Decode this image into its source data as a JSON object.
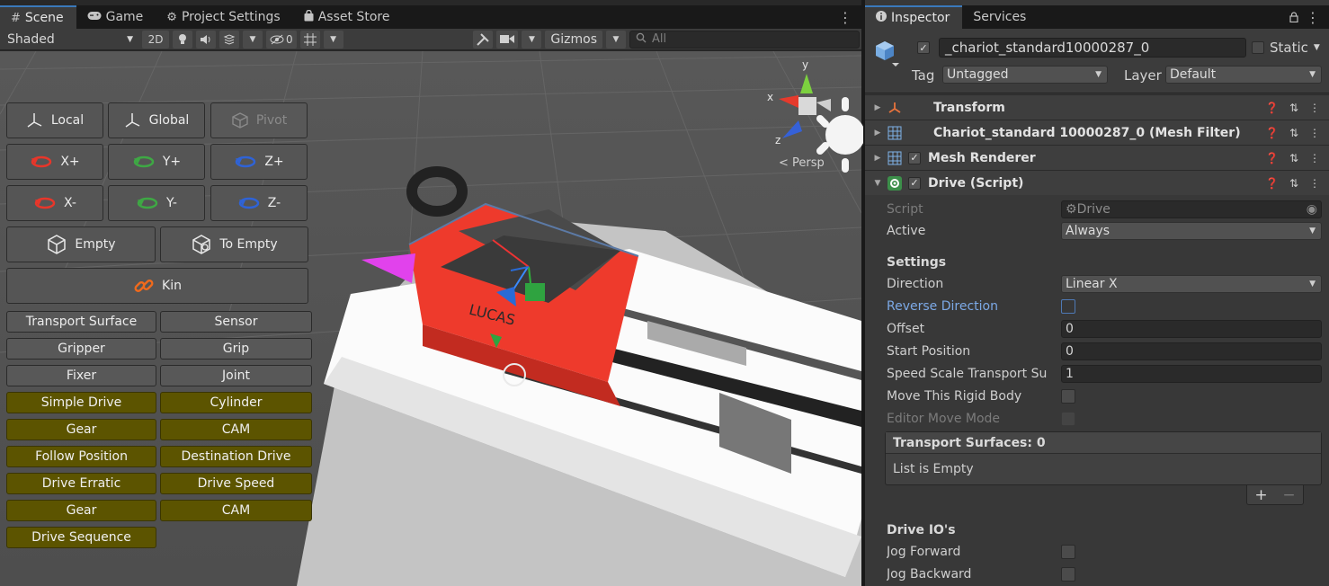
{
  "scene_tabs": [
    {
      "label": "Scene",
      "icon": "hash-icon",
      "active": true
    },
    {
      "label": "Game",
      "icon": "gamepad-icon"
    },
    {
      "label": "Project Settings",
      "icon": "gear-icon"
    },
    {
      "label": "Asset Store",
      "icon": "bag-icon"
    }
  ],
  "toolbar": {
    "shading_mode": "Shaded",
    "mode_2d": "2D",
    "hidden_count": "0",
    "gizmos": "Gizmos",
    "search_placeholder": "All"
  },
  "overlay": {
    "row1": [
      "Local",
      "Global",
      "Pivot"
    ],
    "row2": [
      "X+",
      "Y+",
      "Z+"
    ],
    "row3": [
      "X-",
      "Y-",
      "Z-"
    ],
    "row4": [
      "Empty",
      "To Empty"
    ],
    "kin": "Kin",
    "gray_buttons": [
      "Transport Surface",
      "Sensor",
      "Gripper",
      "Grip",
      "Fixer",
      "Joint"
    ],
    "olive_buttons": [
      "Simple Drive",
      "Cylinder",
      "Gear",
      "CAM",
      "Follow Position",
      "Destination Drive",
      "Drive Erratic",
      "Drive Speed",
      "Gear",
      "CAM",
      "Drive Sequence"
    ],
    "colors": {
      "x": "#e8362a",
      "y": "#3ea844",
      "z": "#2f63d6",
      "kin": "#f06a1c",
      "olive": "#5c5400"
    }
  },
  "scene_text": {
    "gizmo_x": "x",
    "gizmo_y": "y",
    "gizmo_z": "z",
    "persp": "Persp",
    "carriage_label": "LUCAS"
  },
  "inspector_tabs": [
    {
      "label": "Inspector",
      "icon": "info-icon",
      "active": true
    },
    {
      "label": "Services"
    }
  ],
  "object": {
    "name": "_chariot_standard10000287_0",
    "static_label": "Static",
    "tag_label": "Tag",
    "tag_value": "Untagged",
    "layer_label": "Layer",
    "layer_value": "Default"
  },
  "components": [
    {
      "name": "Transform",
      "icon": "transform-icon",
      "checkbox": false
    },
    {
      "name": "Chariot_standard 10000287_0 (Mesh Filter)",
      "icon": "mesh-filter-icon",
      "checkbox": false
    },
    {
      "name": "Mesh Renderer",
      "icon": "mesh-renderer-icon",
      "checkbox": true
    },
    {
      "name": "Drive (Script)",
      "icon": "script-icon",
      "checkbox": true,
      "expanded": true
    }
  ],
  "drive": {
    "script_label": "Script",
    "script_value": "Drive",
    "active_label": "Active",
    "active_value": "Always",
    "settings_header": "Settings",
    "direction_label": "Direction",
    "direction_value": "Linear X",
    "reverse_label": "Reverse Direction",
    "offset_label": "Offset",
    "offset_value": "0",
    "start_label": "Start Position",
    "start_value": "0",
    "speed_label": "Speed Scale Transport Su",
    "speed_value": "1",
    "rigid_label": "Move This Rigid Body",
    "editor_label": "Editor Move Mode",
    "surfaces_header": "Transport Surfaces: 0",
    "list_empty": "List is Empty",
    "plus": "+",
    "minus": "−",
    "io_header": "Drive IO's",
    "jog_fwd": "Jog Forward",
    "jog_back": "Jog Backward"
  }
}
